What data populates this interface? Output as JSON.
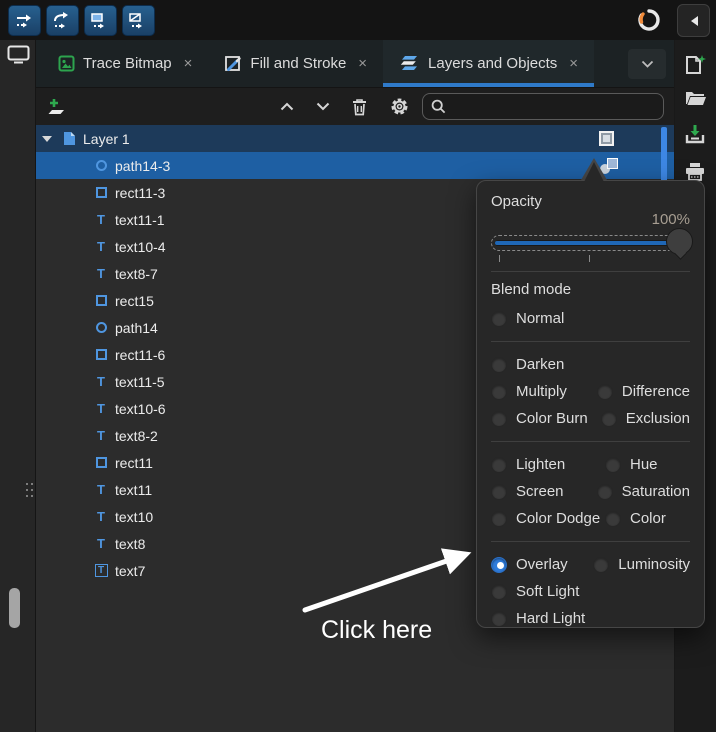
{
  "colors": {
    "accent_blue": "#3584e4",
    "tab_underline": "#2f7ac9",
    "layer_row_bg": "#1d3a5a",
    "selected_row_bg": "#1e5fa3",
    "object_icon_blue": "#4f96e0",
    "popup_bg": "#272727",
    "slider_fill": "#1f67b6",
    "radio_checked": "#2f7cdb",
    "toolbar_button_bg": "#1d4f82",
    "green_accent": "#2ea84e"
  },
  "icons": {
    "top_toolbar": [
      "arrow-offset-icon-1",
      "arrow-offset-icon-2",
      "arrow-offset-icon-3",
      "arrow-offset-icon-4"
    ],
    "tab_icons": [
      "image-icon",
      "fill-stroke-icon",
      "layers-icon"
    ],
    "panel_toolbar": [
      "add-layer-icon",
      "move-up-icon",
      "move-down-icon",
      "trash-icon",
      "gear-icon",
      "search-icon"
    ],
    "right_sidebar": [
      "new-document-icon",
      "open-folder-icon",
      "import-icon",
      "printer-icon"
    ],
    "misc": [
      "sync-icon",
      "collapse-panel-icon",
      "monitor-icon",
      "grip-dots-icon",
      "expander-icon",
      "blend-indicator-icon"
    ]
  },
  "tabs": {
    "close_glyph": "×",
    "items": [
      {
        "label": "Trace Bitmap",
        "icon": "image-icon",
        "active": false
      },
      {
        "label": "Fill and Stroke",
        "icon": "fill-stroke-icon",
        "active": false
      },
      {
        "label": "Layers and Objects",
        "icon": "layers-icon",
        "active": true
      }
    ]
  },
  "panel_toolbar": {
    "search_value": ""
  },
  "layers": [
    {
      "name": "Layer 1",
      "type": "layer",
      "expanded": true,
      "selected": true
    },
    {
      "name": "path14-3",
      "type": "path",
      "selected": true
    },
    {
      "name": "rect11-3",
      "type": "rect"
    },
    {
      "name": "text11-1",
      "type": "text"
    },
    {
      "name": "text10-4",
      "type": "text"
    },
    {
      "name": "text8-7",
      "type": "text"
    },
    {
      "name": "rect15",
      "type": "rect"
    },
    {
      "name": "path14",
      "type": "path"
    },
    {
      "name": "rect11-6",
      "type": "rect"
    },
    {
      "name": "text11-5",
      "type": "text"
    },
    {
      "name": "text10-6",
      "type": "text"
    },
    {
      "name": "text8-2",
      "type": "text"
    },
    {
      "name": "rect11",
      "type": "rect"
    },
    {
      "name": "text11",
      "type": "text"
    },
    {
      "name": "text10",
      "type": "text"
    },
    {
      "name": "text8",
      "type": "text"
    },
    {
      "name": "text7",
      "type": "text-frame"
    }
  ],
  "popup": {
    "opacity": {
      "label": "Opacity",
      "value": "100%",
      "percent": 100
    },
    "blend": {
      "label": "Blend mode",
      "selected": "Overlay",
      "groups": [
        {
          "rows": [
            {
              "left": "Normal"
            }
          ]
        },
        {
          "rows": [
            {
              "left": "Darken"
            },
            {
              "left": "Multiply",
              "right": "Difference"
            },
            {
              "left": "Color Burn",
              "right": "Exclusion"
            }
          ]
        },
        {
          "rows": [
            {
              "left": "Lighten",
              "right": "Hue"
            },
            {
              "left": "Screen",
              "right": "Saturation"
            },
            {
              "left": "Color Dodge",
              "right": "Color"
            }
          ]
        },
        {
          "rows": [
            {
              "left": "Overlay",
              "right": "Luminosity",
              "left_selected": true
            },
            {
              "left": "Soft Light"
            },
            {
              "left": "Hard Light"
            }
          ]
        }
      ]
    }
  },
  "annotation": {
    "text": "Click here"
  }
}
